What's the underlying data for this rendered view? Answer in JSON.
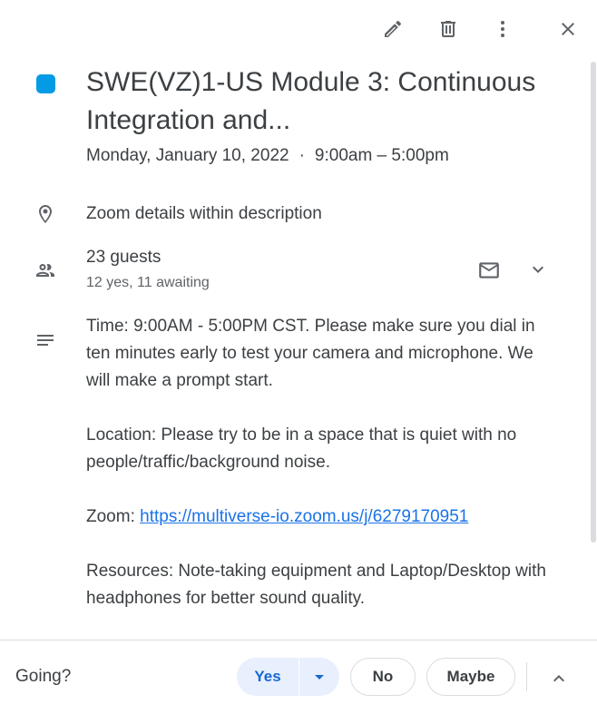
{
  "toolbar": {
    "edit_icon": "edit-icon",
    "delete_icon": "delete-icon",
    "more_icon": "more-vert-icon",
    "close_icon": "close-icon"
  },
  "event": {
    "color": "#039be5",
    "title": "SWE(VZ)1-US Module 3: Continuous Integration and...",
    "date": "Monday, January 10, 2022",
    "separator": "·",
    "time": "9:00am – 5:00pm"
  },
  "location": {
    "icon": "location-pin-icon",
    "text": "Zoom details within description"
  },
  "guests": {
    "icon": "people-icon",
    "count": "23 guests",
    "summary": "12 yes, 11 awaiting"
  },
  "description": {
    "icon": "notes-icon",
    "para1": "Time: 9:00AM - 5:00PM CST. Please make sure you dial in ten minutes early to test your camera and microphone. We will make a prompt start.",
    "para2": "Location: Please try to be in a space that is quiet with no people/traffic/background noise.",
    "zoom_label": "Zoom: ",
    "zoom_link": "https://multiverse-io.zoom.us/j/6279170951",
    "para4": "Resources: Note-taking equipment and Laptop/Desktop with headphones for better sound quality."
  },
  "rsvp": {
    "label": "Going?",
    "yes": "Yes",
    "no": "No",
    "maybe": "Maybe"
  },
  "colors": {
    "accent": "#1a73e8",
    "yes_bg": "#e8f0fe",
    "yes_text": "#1967d2"
  }
}
